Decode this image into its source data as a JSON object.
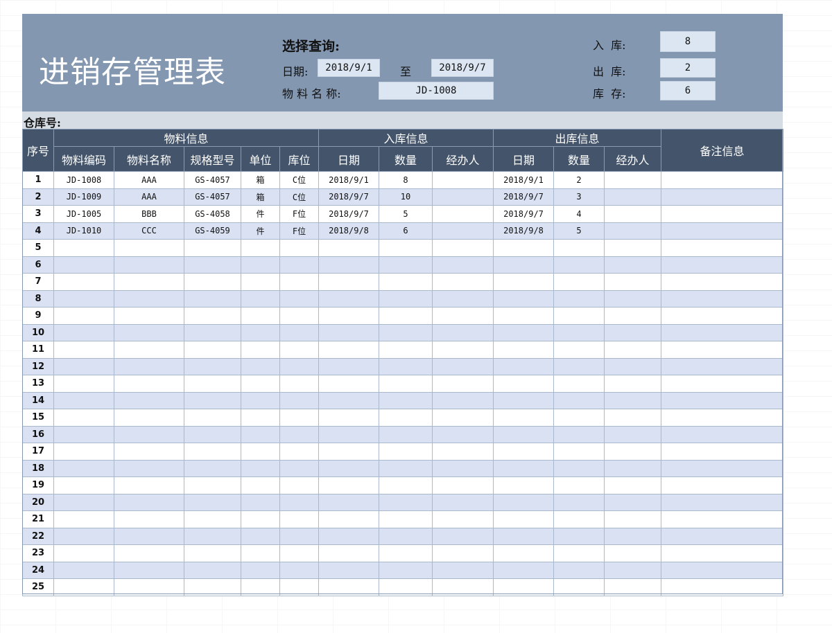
{
  "title": "进销存管理表",
  "query": {
    "heading": "选择查询:",
    "date_label": "日期:",
    "date_from": "2018/9/1",
    "date_to_label": "至",
    "date_to": "2018/9/7",
    "name_label": "物 料 名 称:",
    "name_value": "JD-1008"
  },
  "summary": {
    "in_label": "入  库:",
    "in_value": "8",
    "out_label": "出  库:",
    "out_value": "2",
    "stock_label": "库  存:",
    "stock_value": "6"
  },
  "warehouse_label": "仓库号:",
  "table": {
    "group_headers": {
      "seq": "序号",
      "material": "物料信息",
      "inbound": "入库信息",
      "outbound": "出库信息",
      "remark": "备注信息"
    },
    "sub_headers": {
      "code": "物料编码",
      "name": "物料名称",
      "spec": "规格型号",
      "unit": "单位",
      "loc": "库位",
      "in_date": "日期",
      "in_qty": "数量",
      "in_handler": "经办人",
      "out_date": "日期",
      "out_qty": "数量",
      "out_handler": "经办人"
    },
    "rows": [
      {
        "seq": "1",
        "code": "JD-1008",
        "name": "AAA",
        "spec": "GS-4057",
        "unit": "箱",
        "loc": "C位",
        "in_date": "2018/9/1",
        "in_qty": "8",
        "in_handler": "",
        "out_date": "2018/9/1",
        "out_qty": "2",
        "out_handler": "",
        "remark": ""
      },
      {
        "seq": "2",
        "code": "JD-1009",
        "name": "AAA",
        "spec": "GS-4057",
        "unit": "箱",
        "loc": "C位",
        "in_date": "2018/9/7",
        "in_qty": "10",
        "in_handler": "",
        "out_date": "2018/9/7",
        "out_qty": "3",
        "out_handler": "",
        "remark": ""
      },
      {
        "seq": "3",
        "code": "JD-1005",
        "name": "BBB",
        "spec": "GS-4058",
        "unit": "件",
        "loc": "F位",
        "in_date": "2018/9/7",
        "in_qty": "5",
        "in_handler": "",
        "out_date": "2018/9/7",
        "out_qty": "4",
        "out_handler": "",
        "remark": ""
      },
      {
        "seq": "4",
        "code": "JD-1010",
        "name": "CCC",
        "spec": "GS-4059",
        "unit": "件",
        "loc": "F位",
        "in_date": "2018/9/8",
        "in_qty": "6",
        "in_handler": "",
        "out_date": "2018/9/8",
        "out_qty": "5",
        "out_handler": "",
        "remark": ""
      },
      {
        "seq": "5"
      },
      {
        "seq": "6"
      },
      {
        "seq": "7"
      },
      {
        "seq": "8"
      },
      {
        "seq": "9"
      },
      {
        "seq": "10"
      },
      {
        "seq": "11"
      },
      {
        "seq": "12"
      },
      {
        "seq": "13"
      },
      {
        "seq": "14"
      },
      {
        "seq": "15"
      },
      {
        "seq": "16"
      },
      {
        "seq": "17"
      },
      {
        "seq": "18"
      },
      {
        "seq": "19"
      },
      {
        "seq": "20"
      },
      {
        "seq": "21"
      },
      {
        "seq": "22"
      },
      {
        "seq": "23"
      },
      {
        "seq": "24"
      },
      {
        "seq": "25"
      }
    ]
  },
  "colors": {
    "header_band": "#8497b0",
    "table_header": "#44546a",
    "stripe": "#d9e1f2",
    "input_box": "#dce6f2"
  }
}
